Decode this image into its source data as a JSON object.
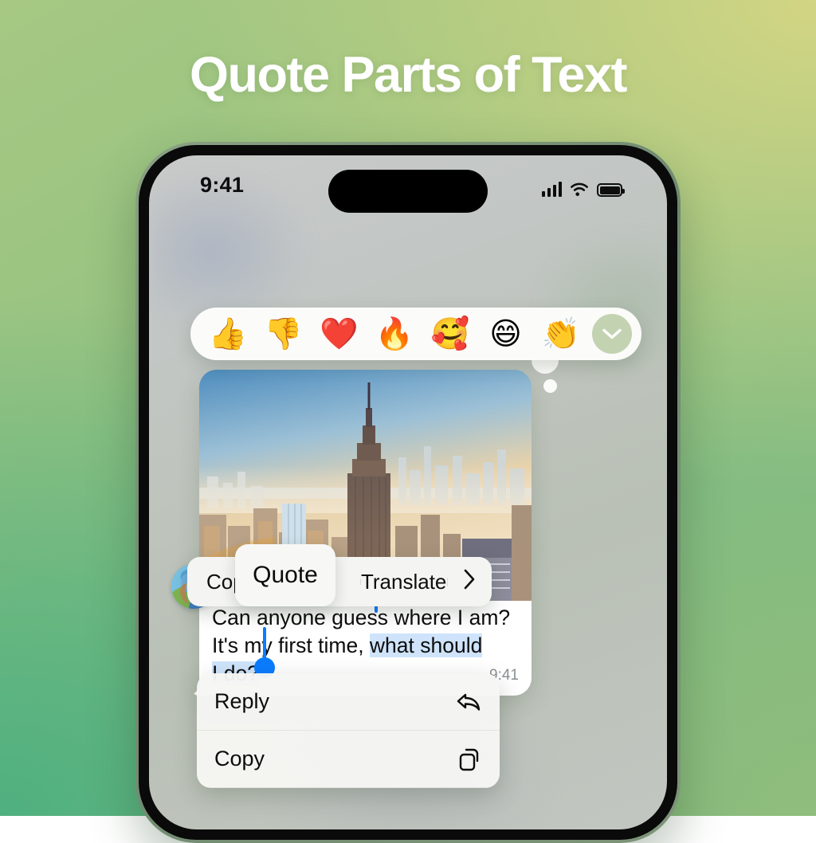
{
  "headline": "Quote Parts of Text",
  "colors": {
    "accent_blue": "#0a7cff",
    "selection_highlight": "#cfe4fb",
    "bg_green_top_left": "#a6c883",
    "bg_yellow_green_top_right": "#d2d583",
    "bg_green_bottom_left": "#4fb07f",
    "bg_green_bottom_right": "#8fbd7d",
    "menu_surface": "#f4f4f2",
    "reaction_more_bg": "#c3d3b2"
  },
  "status_bar": {
    "time": "9:41",
    "signal_icon": "cellular-signal-icon",
    "wifi_icon": "wifi-icon",
    "battery_icon": "battery-full-icon",
    "dynamic_island": "dynamic-island"
  },
  "reaction_bar": {
    "emojis": [
      {
        "name": "thumbs-up-emoji",
        "glyph": "👍"
      },
      {
        "name": "thumbs-down-emoji",
        "glyph": "👎"
      },
      {
        "name": "red-heart-emoji",
        "glyph": "❤️"
      },
      {
        "name": "fire-emoji",
        "glyph": "🔥"
      },
      {
        "name": "smiling-face-with-hearts-emoji",
        "glyph": "🥰"
      },
      {
        "name": "grinning-face-emoji",
        "glyph": "😄"
      },
      {
        "name": "clapping-hands-emoji",
        "glyph": "👏"
      }
    ],
    "more_icon": "chevron-down-icon"
  },
  "message": {
    "photo_alt": "new-york-city-skyline-photo",
    "avatar_alt": "sender-avatar-photo",
    "text_before": "Can anyone guess where I am? It's my first time, ",
    "text_selected": "what should I do?",
    "line1": "Can anyone guess where I am?",
    "line2_prefix": "It's my first time, ",
    "line2_selected": "what should",
    "line3_selected": "I do?",
    "timestamp": "9:41"
  },
  "action_menu": {
    "items": [
      {
        "label": "Copy",
        "name": "action-copy"
      },
      {
        "label": "Quote",
        "name": "action-quote"
      },
      {
        "label": "Translate",
        "name": "action-translate"
      }
    ],
    "more_icon": "chevron-right-icon",
    "highlighted": "Quote"
  },
  "context_menu": {
    "items": [
      {
        "label": "Reply",
        "name": "context-menu-reply",
        "icon": "reply-arrow-icon"
      },
      {
        "label": "Copy",
        "name": "context-menu-copy",
        "icon": "copy-documents-icon"
      }
    ]
  }
}
